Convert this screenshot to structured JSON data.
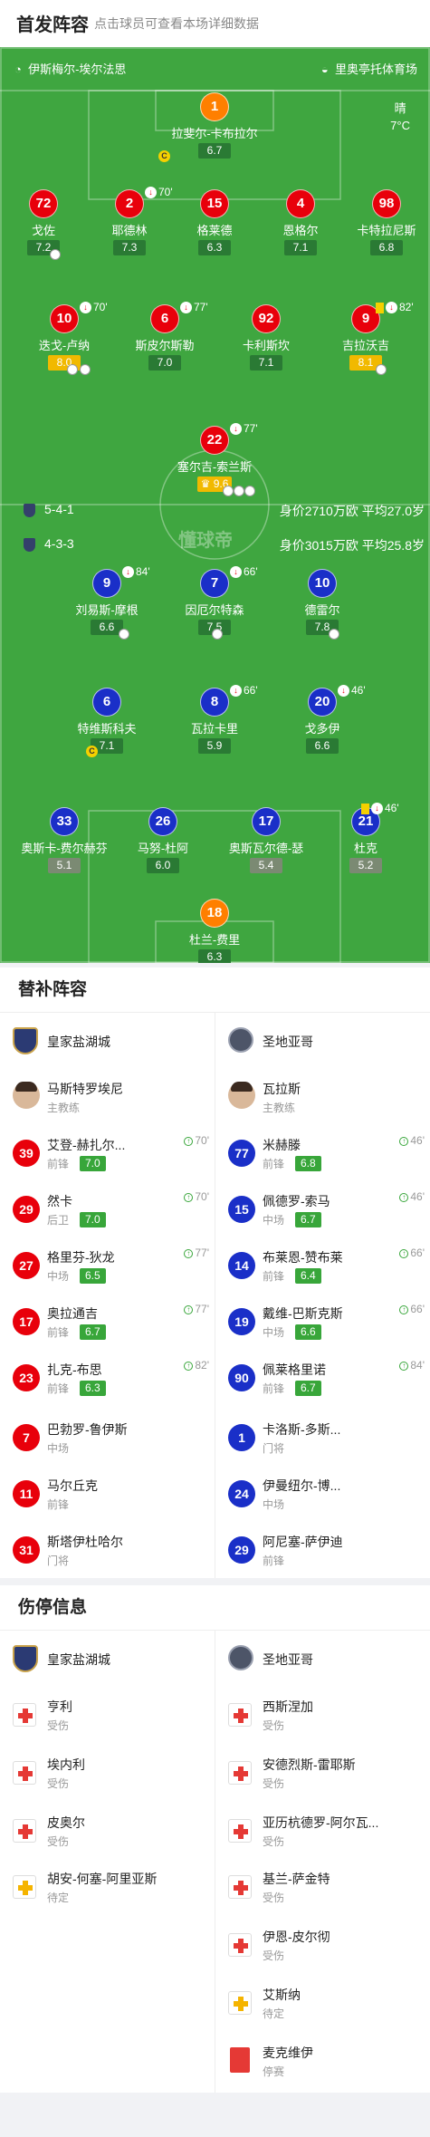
{
  "header": {
    "title": "首发阵容",
    "subtitle": "点击球员可查看本场详细数据"
  },
  "pitch": {
    "home_team": "伊斯梅尔-埃尔法思",
    "venue": "里奥亭托体育场",
    "weather": "晴",
    "temperature": "7°C",
    "watermark": "懂球帝",
    "home_formation": "5-4-1",
    "home_value": "身价2710万欧 平均27.0岁",
    "away_formation": "4-3-3",
    "away_value": "身价3015万欧 平均25.8岁"
  },
  "home_players": [
    {
      "num": "1",
      "name": "拉斐尔-卡布拉尔",
      "rating": "6.7"
    },
    {
      "num": "72",
      "name": "戈佐",
      "rating": "7.2"
    },
    {
      "num": "2",
      "name": "耶德林",
      "rating": "7.3",
      "sub": "70'"
    },
    {
      "num": "15",
      "name": "格莱德",
      "rating": "6.3"
    },
    {
      "num": "4",
      "name": "恩格尔",
      "rating": "7.1"
    },
    {
      "num": "98",
      "name": "卡特拉尼斯",
      "rating": "6.8"
    },
    {
      "num": "10",
      "name": "迭戈-卢纳",
      "rating": "8.0",
      "sub": "70'"
    },
    {
      "num": "6",
      "name": "斯皮尔斯勒",
      "rating": "7.0",
      "sub": "77'"
    },
    {
      "num": "92",
      "name": "卡利斯坎",
      "rating": "7.1"
    },
    {
      "num": "9",
      "name": "吉拉沃吉",
      "rating": "8.1",
      "sub": "82'"
    },
    {
      "num": "22",
      "name": "塞尔吉-索兰斯",
      "rating": "9.6",
      "sub": "77'"
    }
  ],
  "away_players": [
    {
      "num": "9",
      "name": "刘易斯-摩根",
      "rating": "6.6",
      "sub": "84'"
    },
    {
      "num": "7",
      "name": "因厄尔特森",
      "rating": "7.5",
      "sub": "66'"
    },
    {
      "num": "10",
      "name": "德雷尔",
      "rating": "7.8"
    },
    {
      "num": "6",
      "name": "特维斯科夫",
      "rating": "7.1"
    },
    {
      "num": "8",
      "name": "瓦拉卡里",
      "rating": "5.9",
      "sub": "66'"
    },
    {
      "num": "20",
      "name": "戈多伊",
      "rating": "6.6",
      "sub": "46'"
    },
    {
      "num": "33",
      "name": "奥斯卡-费尔赫芬",
      "rating": "5.1"
    },
    {
      "num": "26",
      "name": "马努-杜阿",
      "rating": "6.0"
    },
    {
      "num": "17",
      "name": "奥斯瓦尔德-瑟",
      "rating": "5.4"
    },
    {
      "num": "21",
      "name": "杜克",
      "rating": "5.2",
      "sub": "46'"
    },
    {
      "num": "18",
      "name": "杜兰-费里",
      "rating": "6.3"
    }
  ],
  "subs": {
    "title": "替补阵容",
    "home_team": "皇家盐湖城",
    "away_team": "圣地亚哥",
    "home_coach": {
      "name": "马斯特罗埃尼",
      "role": "主教练"
    },
    "away_coach": {
      "name": "瓦拉斯",
      "role": "主教练"
    },
    "home": [
      {
        "num": "39",
        "name": "艾登-赫扎尔...",
        "pos": "前锋",
        "rating": "7.0",
        "time": "70'"
      },
      {
        "num": "29",
        "name": "然卡",
        "pos": "后卫",
        "rating": "7.0",
        "time": "70'"
      },
      {
        "num": "27",
        "name": "格里芬-狄龙",
        "pos": "中场",
        "rating": "6.5",
        "time": "77'"
      },
      {
        "num": "17",
        "name": "奥拉通吉",
        "pos": "前锋",
        "rating": "6.7",
        "time": "77'"
      },
      {
        "num": "23",
        "name": "扎克-布思",
        "pos": "前锋",
        "rating": "6.3",
        "time": "82'"
      },
      {
        "num": "7",
        "name": "巴勃罗-鲁伊斯",
        "pos": "中场"
      },
      {
        "num": "11",
        "name": "马尔丘克",
        "pos": "前锋"
      },
      {
        "num": "31",
        "name": "斯塔伊杜哈尔",
        "pos": "门将"
      }
    ],
    "away": [
      {
        "num": "77",
        "name": "米赫滕",
        "pos": "前锋",
        "rating": "6.8",
        "time": "46'"
      },
      {
        "num": "15",
        "name": "佩德罗-索马",
        "pos": "中场",
        "rating": "6.7",
        "time": "46'"
      },
      {
        "num": "14",
        "name": "布莱恩-赞布莱",
        "pos": "前锋",
        "rating": "6.4",
        "time": "66'"
      },
      {
        "num": "19",
        "name": "戴维-巴斯克斯",
        "pos": "中场",
        "rating": "6.6",
        "time": "66'"
      },
      {
        "num": "90",
        "name": "佩莱格里诺",
        "pos": "前锋",
        "rating": "6.7",
        "time": "84'"
      },
      {
        "num": "1",
        "name": "卡洛斯-多斯...",
        "pos": "门将"
      },
      {
        "num": "24",
        "name": "伊曼纽尔-博...",
        "pos": "中场"
      },
      {
        "num": "29",
        "name": "阿尼塞-萨伊迪",
        "pos": "前锋"
      }
    ]
  },
  "injuries": {
    "title": "伤停信息",
    "home_team": "皇家盐湖城",
    "away_team": "圣地亚哥",
    "home": [
      {
        "name": "亨利",
        "status": "受伤",
        "icon": "medical-kit-icon"
      },
      {
        "name": "埃内利",
        "status": "受伤",
        "icon": "medical-kit-icon"
      },
      {
        "name": "皮奥尔",
        "status": "受伤",
        "icon": "medical-kit-icon"
      },
      {
        "name": "胡安-何塞-阿里亚斯",
        "status": "待定",
        "icon": "medical-kit-doubtful-icon"
      }
    ],
    "away": [
      {
        "name": "西斯涅加",
        "status": "受伤",
        "icon": "medical-kit-icon"
      },
      {
        "name": "安德烈斯-雷耶斯",
        "status": "受伤",
        "icon": "medical-kit-icon"
      },
      {
        "name": "亚历杭德罗-阿尔瓦...",
        "status": "受伤",
        "icon": "medical-kit-icon"
      },
      {
        "name": "基兰-萨金特",
        "status": "受伤",
        "icon": "medical-kit-icon"
      },
      {
        "name": "伊恩-皮尔彻",
        "status": "受伤",
        "icon": "medical-kit-icon"
      },
      {
        "name": "艾斯纳",
        "status": "待定",
        "icon": "medical-kit-doubtful-icon"
      },
      {
        "name": "麦克维伊",
        "status": "停赛",
        "icon": "red-card-icon"
      }
    ]
  }
}
